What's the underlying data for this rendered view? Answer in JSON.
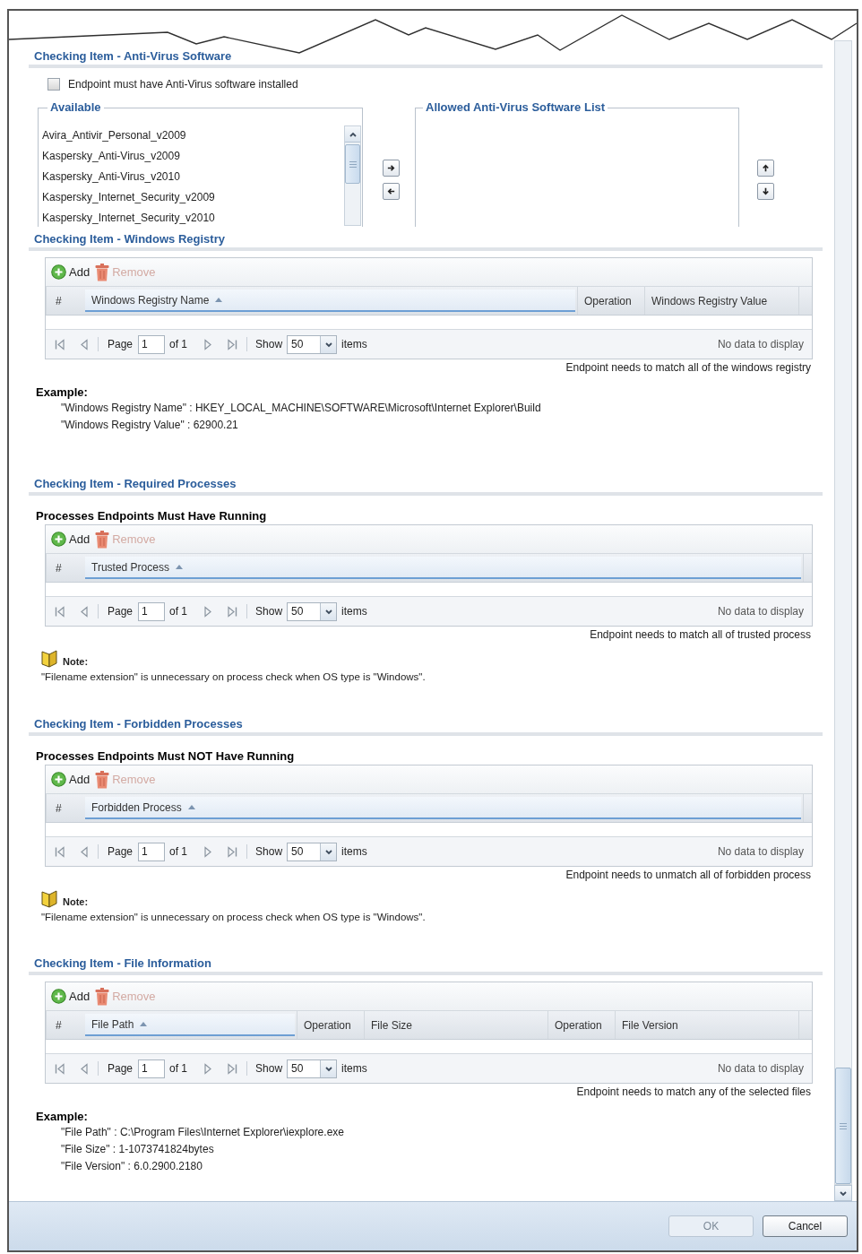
{
  "sections": [
    {
      "kind": "antivirus",
      "title": "Checking Item - Anti-Virus Software",
      "checkbox": {
        "label": "Endpoint must have Anti-Virus software installed",
        "checked": false
      },
      "available": {
        "legend": "Available",
        "items": [
          "Avira_Antivir_Personal_v2009",
          "Kaspersky_Anti-Virus_v2009",
          "Kaspersky_Anti-Virus_v2010",
          "Kaspersky_Internet_Security_v2009",
          "Kaspersky_Internet_Security_v2010"
        ]
      },
      "allowed": {
        "legend": "Allowed Anti-Virus Software List"
      }
    },
    {
      "kind": "grid",
      "title": "Checking Item - Windows Registry",
      "toolbar": [
        {
          "kind": "add",
          "label": "Add",
          "disabled": false
        },
        {
          "kind": "remove",
          "label": "Remove",
          "disabled": true
        }
      ],
      "columns": [
        {
          "label": "#",
          "sorted": false
        },
        {
          "label": "Windows Registry Name",
          "sorted": true
        },
        {
          "label": "Operation",
          "sorted": false
        },
        {
          "label": "Windows Registry Value",
          "sorted": false
        }
      ],
      "pager": {
        "page_label": "Page",
        "page": "1",
        "of": "of 1",
        "show_label": "Show",
        "page_size": "50",
        "items_label": "items",
        "status": "No data to display"
      },
      "caption": "Endpoint needs to match all of the windows registry",
      "example": {
        "title": "Example:",
        "lines": [
          "\"Windows Registry Name\" : HKEY_LOCAL_MACHINE\\SOFTWARE\\Microsoft\\Internet Explorer\\Build",
          "\"Windows Registry Value\" : 62900.21"
        ]
      }
    },
    {
      "kind": "grid",
      "title": "Checking Item - Required Processes",
      "subtitle": "Processes Endpoints Must Have Running",
      "toolbar": [
        {
          "kind": "add",
          "label": "Add",
          "disabled": false
        },
        {
          "kind": "remove",
          "label": "Remove",
          "disabled": true
        }
      ],
      "columns": [
        {
          "label": "#",
          "sorted": false
        },
        {
          "label": "Trusted Process",
          "sorted": true
        }
      ],
      "pager": {
        "page_label": "Page",
        "page": "1",
        "of": "of 1",
        "show_label": "Show",
        "page_size": "50",
        "items_label": "items",
        "status": "No data to display"
      },
      "caption": "Endpoint needs to match all of trusted process",
      "note": {
        "title": "Note:",
        "text": "\"Filename extension\" is unnecessary on process check when OS type is \"Windows\"."
      }
    },
    {
      "kind": "grid",
      "title": "Checking Item - Forbidden Processes",
      "subtitle": "Processes Endpoints Must NOT Have Running",
      "toolbar": [
        {
          "kind": "add",
          "label": "Add",
          "disabled": false
        },
        {
          "kind": "remove",
          "label": "Remove",
          "disabled": true
        }
      ],
      "columns": [
        {
          "label": "#",
          "sorted": false
        },
        {
          "label": "Forbidden Process",
          "sorted": true
        }
      ],
      "pager": {
        "page_label": "Page",
        "page": "1",
        "of": "of 1",
        "show_label": "Show",
        "page_size": "50",
        "items_label": "items",
        "status": "No data to display"
      },
      "caption": "Endpoint needs to unmatch all of forbidden process",
      "note": {
        "title": "Note:",
        "text": "\"Filename extension\" is unnecessary on process check when OS type is \"Windows\"."
      }
    },
    {
      "kind": "grid",
      "title": "Checking Item - File Information",
      "toolbar": [
        {
          "kind": "add",
          "label": "Add",
          "disabled": false
        },
        {
          "kind": "remove",
          "label": "Remove",
          "disabled": true
        }
      ],
      "columns": [
        {
          "label": "#",
          "sorted": false
        },
        {
          "label": "File Path",
          "sorted": true
        },
        {
          "label": "Operation",
          "sorted": false
        },
        {
          "label": "File Size",
          "sorted": false
        },
        {
          "label": "Operation",
          "sorted": false
        },
        {
          "label": "File Version",
          "sorted": false
        }
      ],
      "pager": {
        "page_label": "Page",
        "page": "1",
        "of": "of 1",
        "show_label": "Show",
        "page_size": "50",
        "items_label": "items",
        "status": "No data to display"
      },
      "caption": "Endpoint needs to match any of the selected files",
      "example": {
        "title": "Example:",
        "lines": [
          "\"File Path\" : C:\\Program Files\\Internet Explorer\\iexplore.exe",
          "\"File Size\" : 1-1073741824bytes",
          "\"File Version\" : 6.0.2900.2180"
        ]
      }
    }
  ],
  "buttons": [
    {
      "label": "OK",
      "disabled": true
    },
    {
      "label": "Cancel",
      "disabled": false
    }
  ]
}
